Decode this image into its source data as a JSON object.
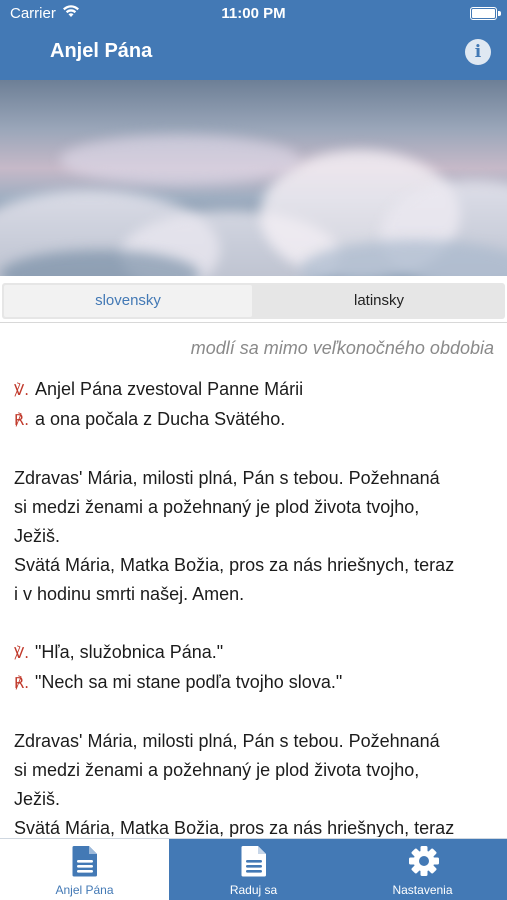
{
  "status_bar": {
    "carrier": "Carrier",
    "time": "11:00 PM"
  },
  "nav": {
    "title": "Anjel Pána",
    "info_icon": "info-icon",
    "info_glyph": "i"
  },
  "colors": {
    "accent": "#4379b5",
    "response_symbol": "#c0392b",
    "note": "#8a8a8a"
  },
  "segment": {
    "options": [
      "slovensky",
      "latinsky"
    ],
    "selected": "slovensky"
  },
  "note": "modlí sa mimo veľkonočného obdobia",
  "prayer": {
    "v_symbol": "℣.",
    "r_symbol": "℟.",
    "v1": "Anjel Pána zvestoval Panne Márii",
    "r1": "a ona počala z Ducha Svätého.",
    "hail1_l1": "Zdravas' Mária, milosti plná, Pán s tebou. Požehnaná",
    "hail1_l2": "si medzi ženami a požehnaný je plod života tvojho,",
    "hail1_l3": "Ježiš.",
    "hail1_l4": "Svätá Mária, Matka Božia, pros za nás hriešnych, teraz",
    "hail1_l5": "i v hodinu smrti našej. Amen.",
    "v2": "\"Hľa, služobnica Pána.\"",
    "r2": "\"Nech sa mi stane podľa tvojho slova.\"",
    "hail2_l1": "Zdravas' Mária, milosti plná, Pán s tebou. Požehnaná",
    "hail2_l2": "si medzi ženami a požehnaný je plod života tvojho,",
    "hail2_l3": "Ježiš.",
    "hail2_l4": "Svätá Mária, Matka Božia, pros za nás hriešnych, teraz"
  },
  "tabs": [
    {
      "label": "Anjel Pána",
      "icon": "document-icon",
      "active": true
    },
    {
      "label": "Raduj sa",
      "icon": "document-icon",
      "active": false
    },
    {
      "label": "Nastavenia",
      "icon": "gear-icon",
      "active": false
    }
  ]
}
